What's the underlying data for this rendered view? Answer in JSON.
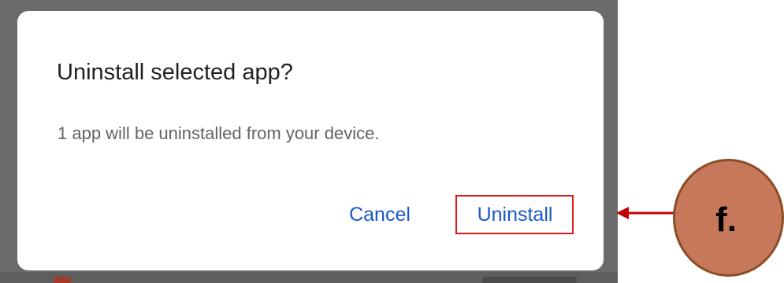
{
  "dialog": {
    "title": "Uninstall selected app?",
    "message": "1 app will be uninstalled from your device.",
    "cancel_label": "Cancel",
    "confirm_label": "Uninstall"
  },
  "annotation": {
    "step_label": "f.",
    "highlight_target": "Uninstall"
  },
  "colors": {
    "button_text": "#1a57c8",
    "highlight_border": "#e01818",
    "badge_fill": "#c8785a",
    "badge_border": "#8a4d25",
    "arrow": "#c00000",
    "backdrop": "#6b6b6b"
  }
}
